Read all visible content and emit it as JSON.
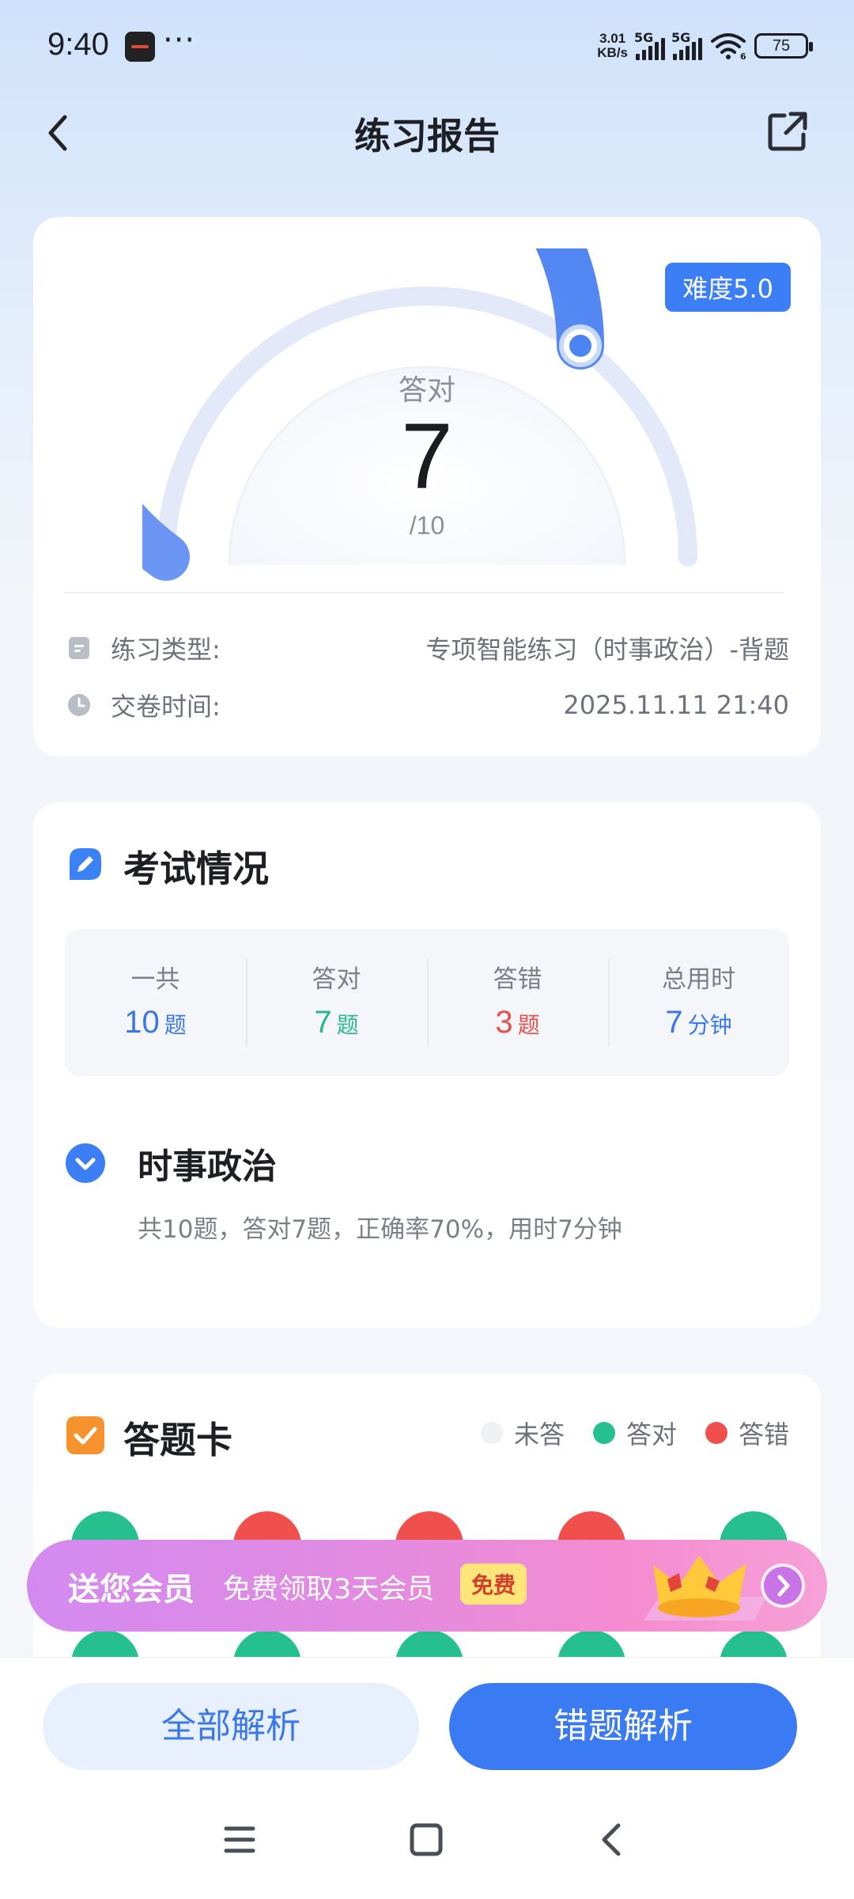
{
  "status_bar": {
    "time": "9:40",
    "more": "···",
    "speed_value": "3.01",
    "speed_unit": "KB/s",
    "net1": "5G",
    "net2": "5G",
    "wifi_sub": "6",
    "battery": "75"
  },
  "nav": {
    "title": "练习报告",
    "back_icon": "chevron-left-icon",
    "share_icon": "share-external-icon"
  },
  "report": {
    "difficulty": "难度5.0",
    "correct_label": "答对",
    "correct_value": "7",
    "total_label": "/10",
    "progress_fraction": 0.7,
    "type_label": "练习类型:",
    "type_value": "专项智能练习（时事政治）-背题",
    "time_label": "交卷时间:",
    "time_value": "2025.11.11 21:40"
  },
  "exam": {
    "title": "考试情况",
    "stats": [
      {
        "label": "一共",
        "value": "10",
        "unit": "题"
      },
      {
        "label": "答对",
        "value": "7",
        "unit": "题"
      },
      {
        "label": "答错",
        "value": "3",
        "unit": "题"
      },
      {
        "label": "总用时",
        "value": "7",
        "unit": "分钟"
      }
    ],
    "subject_title": "时事政治",
    "subject_desc": "共10题，答对7题，正确率70%，用时7分钟"
  },
  "answer_card": {
    "title": "答题卡",
    "legend": [
      {
        "label": "未答",
        "color": "#eef0f3"
      },
      {
        "label": "答对",
        "color": "#26c08f"
      },
      {
        "label": "答错",
        "color": "#f0504c"
      }
    ],
    "colors": {
      "correct": "#26c08f",
      "wrong": "#f0504c"
    },
    "row1": [
      "correct",
      "wrong",
      "wrong",
      "wrong",
      "correct"
    ],
    "row2": [
      "correct",
      "correct",
      "correct",
      "correct",
      "correct"
    ]
  },
  "promo": {
    "main": "送您会员",
    "sub": "免费领取3天会员",
    "badge": "免费"
  },
  "bottom": {
    "all_analysis": "全部解析",
    "wrong_analysis": "错题解析"
  },
  "colors": {
    "accent": "#3a78e8",
    "correct": "#26b98b",
    "wrong": "#e8504a"
  }
}
